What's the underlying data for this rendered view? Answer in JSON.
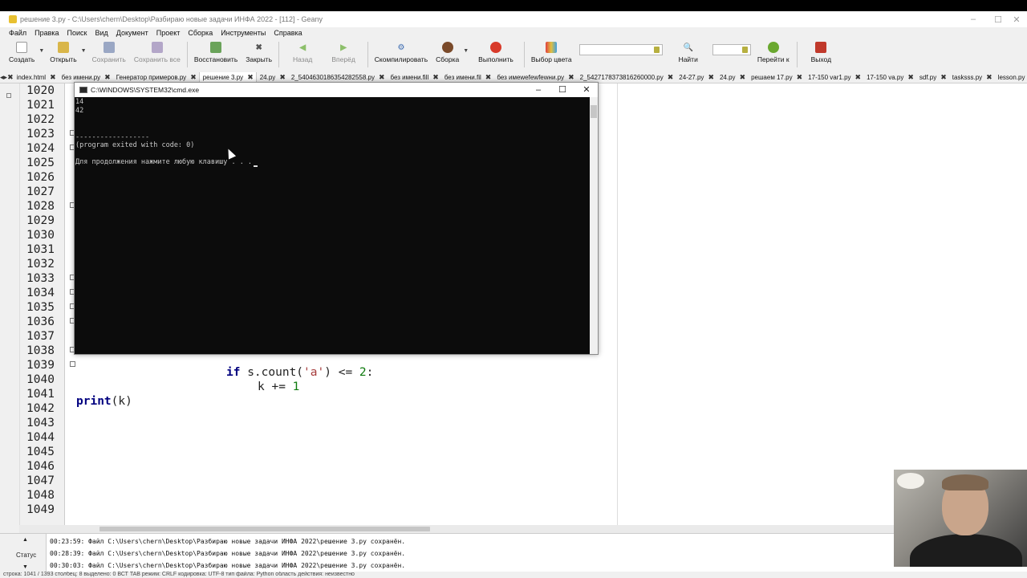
{
  "window": {
    "title": "решение 3.py - C:\\Users\\chern\\Desktop\\Разбираю новые задачи ИНФА 2022 - [112] - Geany",
    "controls": [
      "–",
      "☐",
      "✕"
    ]
  },
  "menu": [
    "Файл",
    "Правка",
    "Поиск",
    "Вид",
    "Документ",
    "Проект",
    "Сборка",
    "Инструменты",
    "Справка"
  ],
  "toolbar": {
    "create": "Создать",
    "open": "Открыть",
    "save": "Сохранить",
    "save_all": "Сохранить все",
    "restore": "Восстановить",
    "close": "Закрыть",
    "back": "Назад",
    "forward": "Вперёд",
    "compile": "Скомпилировать",
    "build": "Сборка",
    "run": "Выполнить",
    "color": "Выбор цвета",
    "find": "Найти",
    "goto": "Перейти к",
    "quit": "Выход"
  },
  "tabs": [
    {
      "label": "index.html",
      "active": false
    },
    {
      "label": "без имени.ру",
      "active": false
    },
    {
      "label": "Генератор примеров.ру",
      "active": false
    },
    {
      "label": "решение 3.py",
      "active": true
    },
    {
      "label": "24.py",
      "active": false
    },
    {
      "label": "2_5404630186354282558.py",
      "active": false
    },
    {
      "label": "без имени.fill",
      "active": false
    },
    {
      "label": "без имени.fil",
      "active": false
    },
    {
      "label": "без имеwefewfewни.py",
      "active": false
    },
    {
      "label": "2_5427178373816260000.py",
      "active": false
    },
    {
      "label": "24-27.py",
      "active": false
    },
    {
      "label": "24.py",
      "active": false
    },
    {
      "label": "решаем 17.py",
      "active": false
    },
    {
      "label": "17-150 var1.py",
      "active": false
    },
    {
      "label": "17-150 va.py",
      "active": false
    },
    {
      "label": "sdf.py",
      "active": false
    },
    {
      "label": "tasksss.py",
      "active": false
    },
    {
      "label": "lesson.py",
      "active": false
    }
  ],
  "editor": {
    "line_numbers": [
      "1020",
      "1021",
      "1022",
      "1023",
      "1024",
      "1025",
      "1026",
      "1027",
      "1028",
      "1029",
      "1030",
      "1031",
      "1032",
      "1033",
      "1034",
      "1035",
      "1036",
      "1037",
      "1038",
      "1039",
      "1040",
      "1041",
      "1042",
      "1043",
      "1044",
      "1045",
      "1046",
      "1047",
      "1048",
      "1049"
    ],
    "code": {
      "if_kw": "if",
      "s_count": " s.count(",
      "arg": "'a'",
      "cmp": ") <= ",
      "two": "2",
      "colon": ":",
      "k_inc": "k += ",
      "one": "1",
      "print_kw": "print",
      "print_arg": "(k)"
    }
  },
  "cmd": {
    "title": "C:\\WINDOWS\\SYSTEM32\\cmd.exe",
    "lines": [
      "14",
      "42",
      "",
      "------------------",
      "(program exited with code: 0)",
      "",
      "Для продолжения нажмите любую клавишу . . ."
    ]
  },
  "messages": {
    "label": "Статус",
    "items": [
      "00:23:59: Файл C:\\Users\\chern\\Desktop\\Разбираю новые задачи ИНФА 2022\\решение 3.py сохранён.",
      "00:28:39: Файл C:\\Users\\chern\\Desktop\\Разбираю новые задачи ИНФА 2022\\решение 3.py сохранён.",
      "00:30:03: Файл C:\\Users\\chern\\Desktop\\Разбираю новые задачи ИНФА 2022\\решение 3.py сохранён."
    ]
  },
  "status": "строка: 1041 / 1393    столбец: 8    выделено: 0    ВСТ    TAB    режим: CRLF    кодировка: UTF-8    тип файла: Python    область действия: неизвестно",
  "colors": {
    "keyword": "#00007f",
    "string": "#a63c3c",
    "number": "#0d7a0d",
    "console_bg": "#0c0c0c"
  }
}
